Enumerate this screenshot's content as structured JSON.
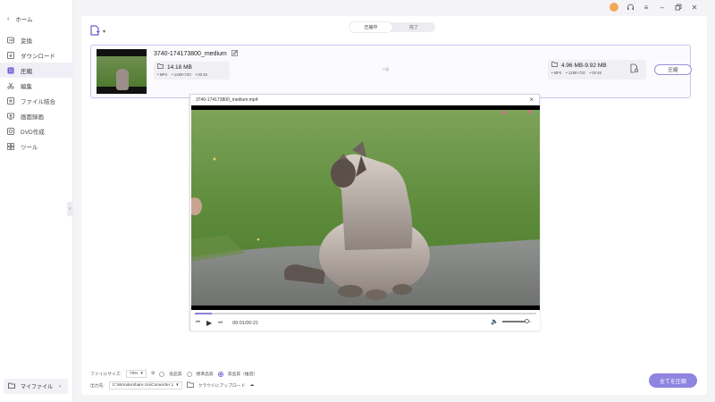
{
  "sidebar": {
    "home_label": "ホーム",
    "items": [
      {
        "label": "変換",
        "icon": "convert-icon"
      },
      {
        "label": "ダウンロード",
        "icon": "download-icon"
      },
      {
        "label": "圧縮",
        "icon": "compress-icon",
        "active": true
      },
      {
        "label": "編集",
        "icon": "edit-icon"
      },
      {
        "label": "ファイル結合",
        "icon": "merge-icon"
      },
      {
        "label": "画面録画",
        "icon": "record-icon"
      },
      {
        "label": "DVD作成",
        "icon": "dvd-icon"
      },
      {
        "label": "ツール",
        "icon": "tools-icon"
      }
    ],
    "myfiles_label": "マイファイル"
  },
  "tabs": [
    "圧縮中",
    "完了"
  ],
  "file": {
    "name": "3740-174173800_medium",
    "source_size": "14.18 MB",
    "source_meta": [
      "MP4",
      "1280×720",
      "00:48"
    ],
    "target_size": "4.96 MB-9.92 MB",
    "target_meta": [
      "MP4",
      "1280×720",
      "00:48"
    ],
    "compress_label": "圧縮"
  },
  "preview": {
    "title": "3740-174173800_medium.mp4",
    "time": "00:01/00:21",
    "progress_fraction": 0.05,
    "volume_fraction": 0.85
  },
  "bottom": {
    "filesize_label": "ファイルサイズ:",
    "filesize_value": "79%",
    "quality_options": [
      "低品質",
      "標準品質",
      "高品質（推奨）"
    ],
    "quality_selected": 2,
    "output_label": "出力先:",
    "output_path": "C:\\Wondershare UniConverter 1",
    "upload_label": "クラウドにアップロード",
    "compress_all_label": "全てを圧縮"
  },
  "colors": {
    "accent": "#8f84e0",
    "card_border": "#c9c4ee"
  }
}
